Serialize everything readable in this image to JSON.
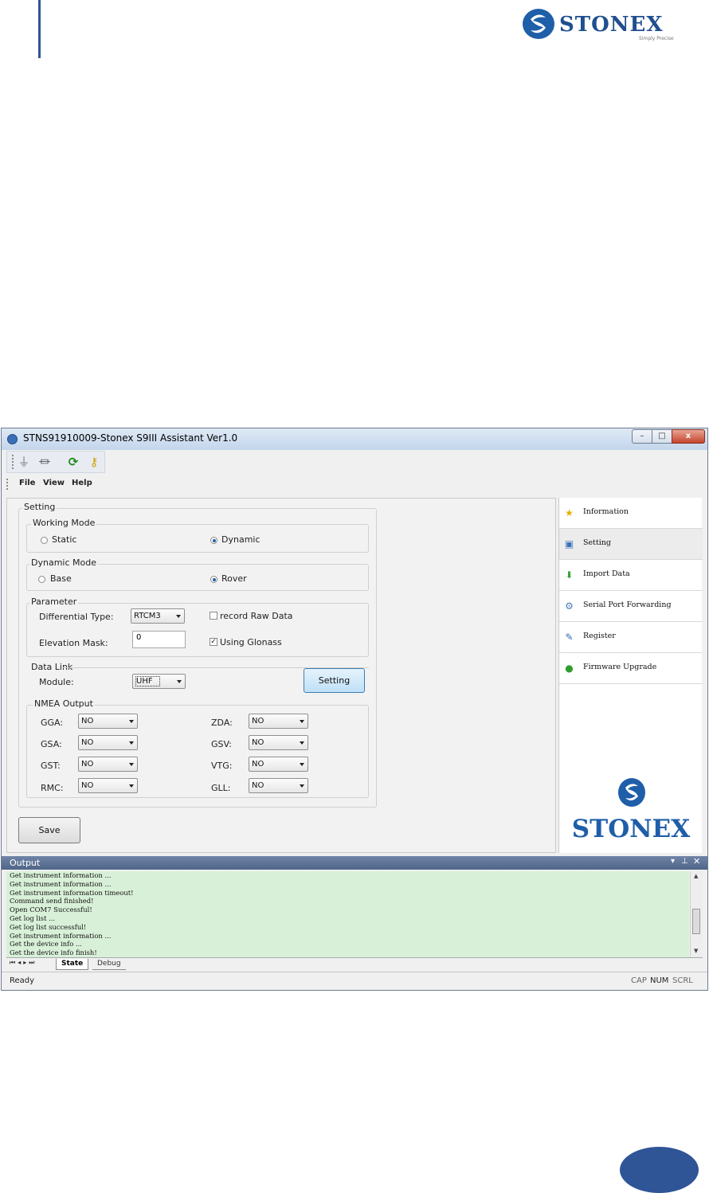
{
  "header": {
    "logo_text": "STONEX",
    "logo_tagline": "Simply Precise"
  },
  "window": {
    "title": "STNS91910009-Stonex S9III Assistant Ver1.0",
    "menu": [
      "File",
      "View",
      "Help"
    ],
    "caption": {
      "minimize": "–",
      "maximize": "□",
      "close": "x"
    }
  },
  "setting": {
    "group_label": "Setting",
    "working_mode": {
      "label": "Working Mode",
      "options": [
        "Static",
        "Dynamic"
      ],
      "selected": "Dynamic"
    },
    "dynamic_mode": {
      "label": "Dynamic Mode",
      "options": [
        "Base",
        "Rover"
      ],
      "selected": "Rover"
    },
    "parameter": {
      "label": "Parameter",
      "differential_type_label": "Differential Type:",
      "differential_type_value": "RTCM3",
      "record_raw_label": "record Raw Data",
      "record_raw_checked": false,
      "elevation_mask_label": "Elevation Mask:",
      "elevation_mask_value": "0",
      "using_glonass_label": "Using Glonass",
      "using_glonass_checked": true
    },
    "data_link": {
      "label": "Data Link",
      "module_label": "Module:",
      "module_value": "UHF",
      "setting_button": "Setting"
    },
    "nmea": {
      "label": "NMEA Output",
      "left": [
        {
          "label": "GGA:",
          "value": "NO"
        },
        {
          "label": "GSA:",
          "value": "NO"
        },
        {
          "label": "GST:",
          "value": "NO"
        },
        {
          "label": "RMC:",
          "value": "NO"
        }
      ],
      "right": [
        {
          "label": "ZDA:",
          "value": "NO"
        },
        {
          "label": "GSV:",
          "value": "NO"
        },
        {
          "label": "VTG:",
          "value": "NO"
        },
        {
          "label": "GLL:",
          "value": "NO"
        }
      ]
    },
    "save_button": "Save"
  },
  "sidebar": {
    "items": [
      {
        "label": "Information",
        "icon": "star-icon",
        "selected": false
      },
      {
        "label": "Setting",
        "icon": "settings-icon",
        "selected": true
      },
      {
        "label": "Import Data",
        "icon": "download-arrow-icon",
        "selected": false
      },
      {
        "label": "Serial Port Forwarding",
        "icon": "port-icon",
        "selected": false
      },
      {
        "label": "Register",
        "icon": "register-icon",
        "selected": false
      },
      {
        "label": "Firmware Upgrade",
        "icon": "upgrade-icon",
        "selected": false
      }
    ],
    "brand": "STONEX"
  },
  "output": {
    "title": "Output",
    "lines": [
      "Get instrument information ...",
      "Get instrument information ...",
      "Get instrument information timeout!",
      "Command send finished!",
      "Open COM7 Successful!",
      "Get log list ...",
      "Get log list successful!",
      "Get instrument information ...",
      "Get the device info ...",
      "Get the device info finish!"
    ],
    "tabs": [
      "State",
      "Debug"
    ]
  },
  "status": {
    "left": "Ready",
    "indicators": [
      "CAP",
      "NUM",
      "SCRL"
    ]
  },
  "colors": {
    "accent_blue": "#2f5597",
    "log_bg": "#d8f0d8",
    "brand_blue": "#1f5ea8"
  }
}
